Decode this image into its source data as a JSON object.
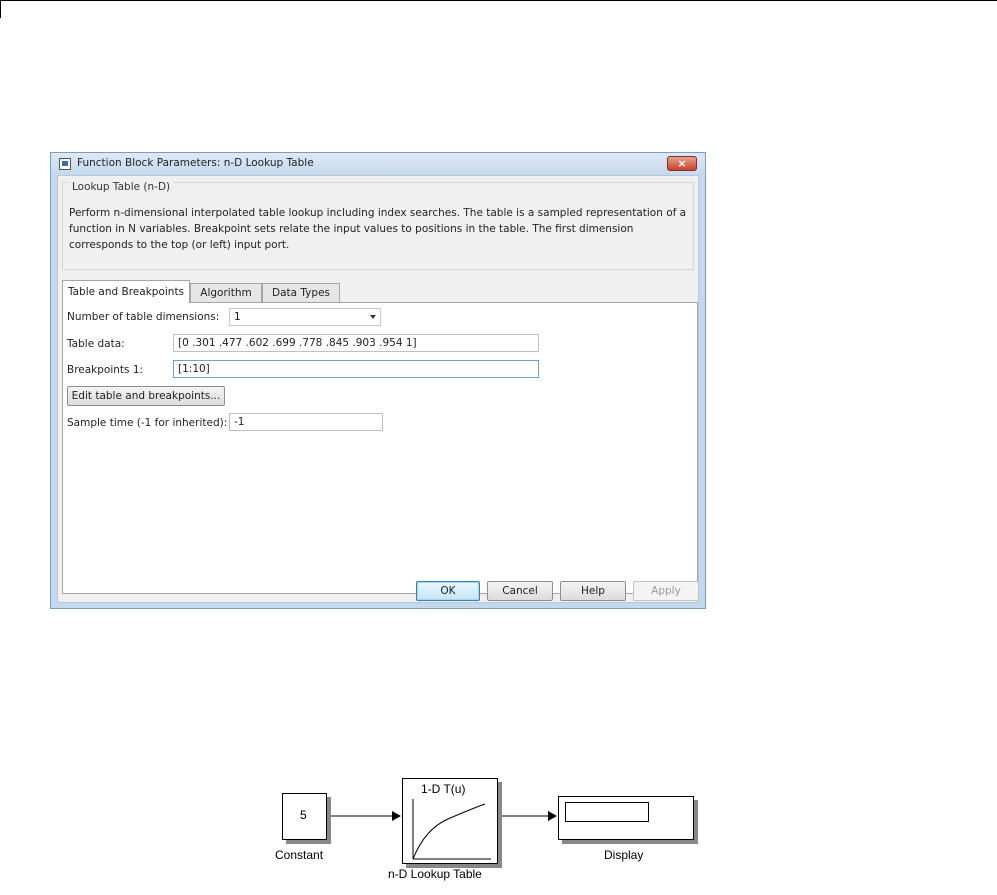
{
  "dialog": {
    "title": "Function Block Parameters: n-D Lookup Table",
    "close_glyph": "×",
    "group": {
      "legend": "Lookup Table (n-D)",
      "description": "Perform n-dimensional interpolated table lookup including index searches. The table is a sampled representation of a function in N variables. Breakpoint sets relate the input values to positions in the table. The first dimension corresponds to the top (or left) input port."
    },
    "tabs": [
      {
        "label": "Table and Breakpoints",
        "active": true
      },
      {
        "label": "Algorithm",
        "active": false
      },
      {
        "label": "Data Types",
        "active": false
      }
    ],
    "params": {
      "num_dims_label": "Number of table dimensions:",
      "num_dims_value": "1",
      "table_data_label": "Table data:",
      "table_data_value": "[0 .301 .477 .602 .699 .778 .845 .903 .954 1]",
      "breakpoints_label": "Breakpoints 1:",
      "breakpoints_value": "[1:10]",
      "edit_button": "Edit table and breakpoints...",
      "sample_time_label": "Sample time (-1 for inherited):",
      "sample_time_value": "-1"
    },
    "buttons": {
      "ok": "OK",
      "cancel": "Cancel",
      "help": "Help",
      "apply": "Apply"
    }
  },
  "diagram": {
    "constant_value": "5",
    "constant_label": "Constant",
    "lookup_title": "1-D T(u)",
    "lookup_label": "n-D Lookup Table",
    "display_label": "Display"
  }
}
